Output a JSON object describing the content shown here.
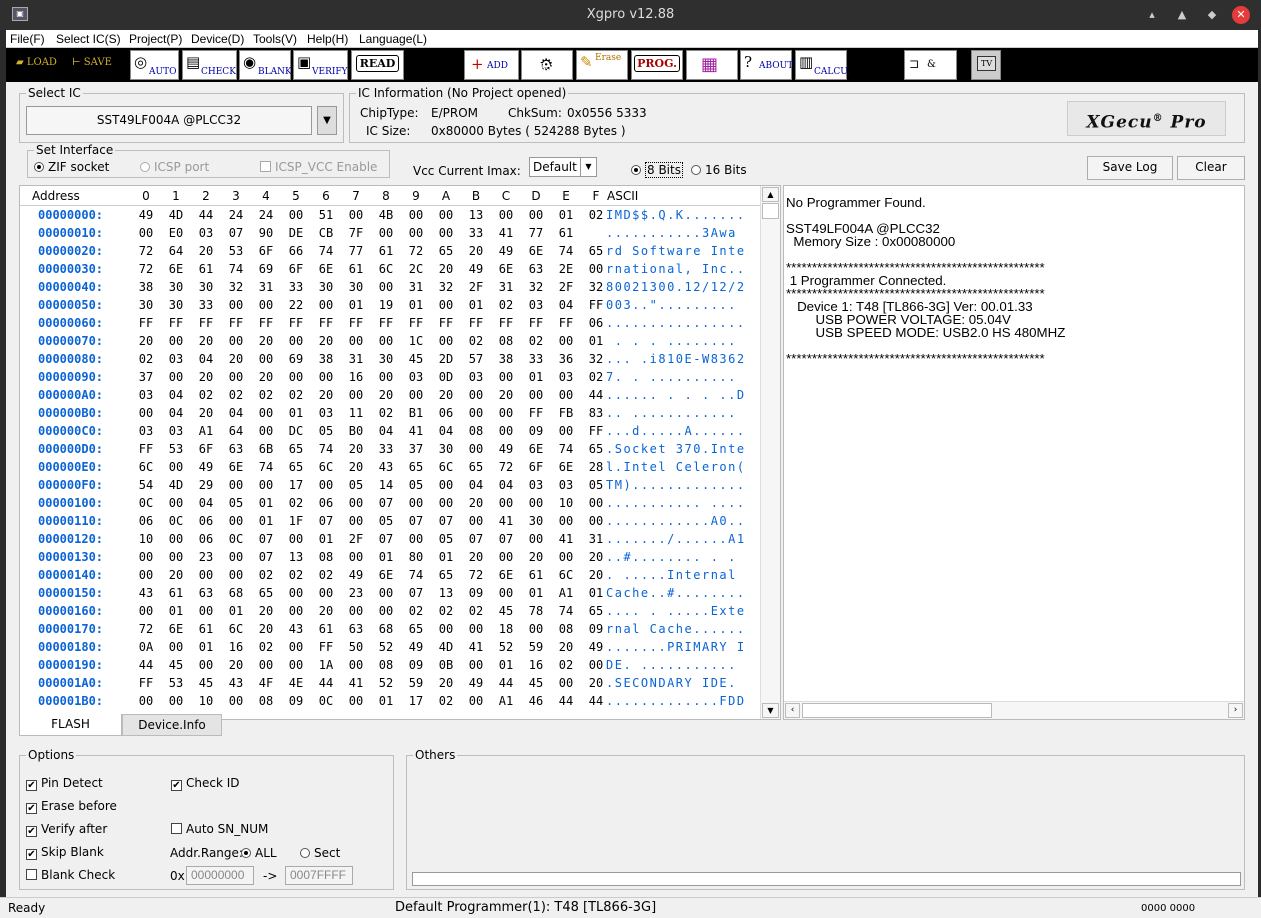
{
  "window": {
    "title": "Xgpro v12.88",
    "app_icon": "xgpro-app-icon"
  },
  "menu": [
    "File(F)",
    "Select IC(S)",
    "Project(P)",
    "Device(D)",
    "Tools(V)",
    "Help(H)",
    "Language(L)"
  ],
  "toolbar": {
    "load": "LOAD",
    "save": "SAVE",
    "auto": "AUTO",
    "check": "CHECK",
    "blank": "BLANK",
    "verify": "VERIFY",
    "read": "READ",
    "add": "ADD",
    "ram": "RAM",
    "erase": "Erase",
    "prog": "PROG.",
    "about": "ABOUT",
    "calcu": "CALCU.",
    "logic": "&",
    "tv": "TV"
  },
  "select_ic": {
    "group_label": "Select IC",
    "value": "SST49LF004A @PLCC32"
  },
  "ic_info": {
    "group_label": "IC Information (No Project opened)",
    "chiptype_label": "ChipType:",
    "chiptype": "E/PROM",
    "chksum_label": "ChkSum:",
    "chksum": "0x0556 5333",
    "icsize_label": "IC Size:",
    "icsize": "0x80000 Bytes ( 524288 Bytes )",
    "logo": "XGecu",
    "logo_reg": "®",
    "logo_tail": "Pro"
  },
  "interface": {
    "group_label": "Set Interface",
    "zif": "ZIF socket",
    "icsp": "ICSP port",
    "icsp_vcc": "ICSP_VCC Enable"
  },
  "vcc": {
    "label": "Vcc Current Imax:",
    "value": "Default"
  },
  "bits": {
    "b8": "8 Bits",
    "b16": "16 Bits"
  },
  "buttons": {
    "save_log": "Save Log",
    "clear": "Clear"
  },
  "hex": {
    "address_header": "Address",
    "columns": [
      "0",
      "1",
      "2",
      "3",
      "4",
      "5",
      "6",
      "7",
      "8",
      "9",
      "A",
      "B",
      "C",
      "D",
      "E",
      "F"
    ],
    "ascii_header": "ASCII",
    "rows": [
      {
        "a": "00000000:",
        "h": [
          "49",
          "4D",
          "44",
          "24",
          "24",
          "00",
          "51",
          "00",
          "4B",
          "00",
          "00",
          "13",
          "00",
          "00",
          "01",
          "02"
        ],
        "t": "IMD$$.Q.K......."
      },
      {
        "a": "00000010:",
        "h": [
          "00",
          "E0",
          "03",
          "07",
          "90",
          "DE",
          "CB",
          "7F",
          "00",
          "00",
          "00",
          "33",
          "41",
          "77",
          "61"
        ],
        "t": "...........3Awa"
      },
      {
        "a": "00000020:",
        "h": [
          "72",
          "64",
          "20",
          "53",
          "6F",
          "66",
          "74",
          "77",
          "61",
          "72",
          "65",
          "20",
          "49",
          "6E",
          "74",
          "65"
        ],
        "t": "rd Software Inte"
      },
      {
        "a": "00000030:",
        "h": [
          "72",
          "6E",
          "61",
          "74",
          "69",
          "6F",
          "6E",
          "61",
          "6C",
          "2C",
          "20",
          "49",
          "6E",
          "63",
          "2E",
          "00"
        ],
        "t": "rnational, Inc.."
      },
      {
        "a": "00000040:",
        "h": [
          "38",
          "30",
          "30",
          "32",
          "31",
          "33",
          "30",
          "30",
          "00",
          "31",
          "32",
          "2F",
          "31",
          "32",
          "2F",
          "32"
        ],
        "t": "80021300.12/12/2"
      },
      {
        "a": "00000050:",
        "h": [
          "30",
          "30",
          "33",
          "00",
          "00",
          "22",
          "00",
          "01",
          "19",
          "01",
          "00",
          "01",
          "02",
          "03",
          "04",
          "FF"
        ],
        "t": "003..\"........."
      },
      {
        "a": "00000060:",
        "h": [
          "FF",
          "FF",
          "FF",
          "FF",
          "FF",
          "FF",
          "FF",
          "FF",
          "FF",
          "FF",
          "FF",
          "FF",
          "FF",
          "FF",
          "FF",
          "06"
        ],
        "t": "................"
      },
      {
        "a": "00000070:",
        "h": [
          "20",
          "00",
          "20",
          "00",
          "20",
          "00",
          "20",
          "00",
          "00",
          "1C",
          "00",
          "02",
          "08",
          "02",
          "00",
          "01"
        ],
        "t": " . . . ........"
      },
      {
        "a": "00000080:",
        "h": [
          "02",
          "03",
          "04",
          "20",
          "00",
          "69",
          "38",
          "31",
          "30",
          "45",
          "2D",
          "57",
          "38",
          "33",
          "36",
          "32"
        ],
        "t": "... .i810E-W8362"
      },
      {
        "a": "00000090:",
        "h": [
          "37",
          "00",
          "20",
          "00",
          "20",
          "00",
          "00",
          "16",
          "00",
          "03",
          "0D",
          "03",
          "00",
          "01",
          "03",
          "02"
        ],
        "t": "7. . .........."
      },
      {
        "a": "000000A0:",
        "h": [
          "03",
          "04",
          "02",
          "02",
          "02",
          "02",
          "20",
          "00",
          "20",
          "00",
          "20",
          "00",
          "20",
          "00",
          "00",
          "44"
        ],
        "t": "...... . . . ..D"
      },
      {
        "a": "000000B0:",
        "h": [
          "00",
          "04",
          "20",
          "04",
          "00",
          "01",
          "03",
          "11",
          "02",
          "B1",
          "06",
          "00",
          "00",
          "FF",
          "FB",
          "83"
        ],
        "t": ".. ............"
      },
      {
        "a": "000000C0:",
        "h": [
          "03",
          "03",
          "A1",
          "64",
          "00",
          "DC",
          "05",
          "B0",
          "04",
          "41",
          "04",
          "08",
          "00",
          "09",
          "00",
          "FF"
        ],
        "t": "...d.....A......"
      },
      {
        "a": "000000D0:",
        "h": [
          "FF",
          "53",
          "6F",
          "63",
          "6B",
          "65",
          "74",
          "20",
          "33",
          "37",
          "30",
          "00",
          "49",
          "6E",
          "74",
          "65"
        ],
        "t": ".Socket 370.Inte"
      },
      {
        "a": "000000E0:",
        "h": [
          "6C",
          "00",
          "49",
          "6E",
          "74",
          "65",
          "6C",
          "20",
          "43",
          "65",
          "6C",
          "65",
          "72",
          "6F",
          "6E",
          "28"
        ],
        "t": "l.Intel Celeron("
      },
      {
        "a": "000000F0:",
        "h": [
          "54",
          "4D",
          "29",
          "00",
          "00",
          "17",
          "00",
          "05",
          "14",
          "05",
          "00",
          "04",
          "04",
          "03",
          "03",
          "05"
        ],
        "t": "TM)............."
      },
      {
        "a": "00000100:",
        "h": [
          "0C",
          "00",
          "04",
          "05",
          "01",
          "02",
          "06",
          "00",
          "07",
          "00",
          "00",
          "20",
          "00",
          "00",
          "10",
          "00"
        ],
        "t": "........... ...."
      },
      {
        "a": "00000110:",
        "h": [
          "06",
          "0C",
          "06",
          "00",
          "01",
          "1F",
          "07",
          "00",
          "05",
          "07",
          "07",
          "00",
          "41",
          "30",
          "00",
          "00"
        ],
        "t": "............A0.."
      },
      {
        "a": "00000120:",
        "h": [
          "10",
          "00",
          "06",
          "0C",
          "07",
          "00",
          "01",
          "2F",
          "07",
          "00",
          "05",
          "07",
          "07",
          "00",
          "41",
          "31"
        ],
        "t": "......./......A1"
      },
      {
        "a": "00000130:",
        "h": [
          "00",
          "00",
          "23",
          "00",
          "07",
          "13",
          "08",
          "00",
          "01",
          "80",
          "01",
          "20",
          "00",
          "20",
          "00",
          "20"
        ],
        "t": "..#........ . ."
      },
      {
        "a": "00000140:",
        "h": [
          "00",
          "20",
          "00",
          "00",
          "02",
          "02",
          "02",
          "49",
          "6E",
          "74",
          "65",
          "72",
          "6E",
          "61",
          "6C",
          "20"
        ],
        "t": ". .....Internal "
      },
      {
        "a": "00000150:",
        "h": [
          "43",
          "61",
          "63",
          "68",
          "65",
          "00",
          "00",
          "23",
          "00",
          "07",
          "13",
          "09",
          "00",
          "01",
          "A1",
          "01"
        ],
        "t": "Cache..#........"
      },
      {
        "a": "00000160:",
        "h": [
          "00",
          "01",
          "00",
          "01",
          "20",
          "00",
          "20",
          "00",
          "00",
          "02",
          "02",
          "02",
          "45",
          "78",
          "74",
          "65"
        ],
        "t": ".... . .....Exte"
      },
      {
        "a": "00000170:",
        "h": [
          "72",
          "6E",
          "61",
          "6C",
          "20",
          "43",
          "61",
          "63",
          "68",
          "65",
          "00",
          "00",
          "18",
          "00",
          "08",
          "09"
        ],
        "t": "rnal Cache......"
      },
      {
        "a": "00000180:",
        "h": [
          "0A",
          "00",
          "01",
          "16",
          "02",
          "00",
          "FF",
          "50",
          "52",
          "49",
          "4D",
          "41",
          "52",
          "59",
          "20",
          "49"
        ],
        "t": ".......PRIMARY I"
      },
      {
        "a": "00000190:",
        "h": [
          "44",
          "45",
          "00",
          "20",
          "00",
          "00",
          "1A",
          "00",
          "08",
          "09",
          "0B",
          "00",
          "01",
          "16",
          "02",
          "00"
        ],
        "t": "DE. ..........."
      },
      {
        "a": "000001A0:",
        "h": [
          "FF",
          "53",
          "45",
          "43",
          "4F",
          "4E",
          "44",
          "41",
          "52",
          "59",
          "20",
          "49",
          "44",
          "45",
          "00",
          "20"
        ],
        "t": ".SECONDARY IDE. "
      },
      {
        "a": "000001B0:",
        "h": [
          "00",
          "00",
          "10",
          "00",
          "08",
          "09",
          "0C",
          "00",
          "01",
          "17",
          "02",
          "00",
          "A1",
          "46",
          "44",
          "44"
        ],
        "t": ".............FDD"
      }
    ]
  },
  "log": {
    "lines": [
      "No Programmer Found.",
      "",
      "SST49LF004A @PLCC32",
      "  Memory Size : 0x00080000",
      "",
      "**************************************************",
      " 1 Programmer Connected.",
      "**************************************************",
      "   Device 1: T48 [TL866-3G] Ver: 00.01.33",
      "        USB POWER VOLTAGE: 05.04V",
      "        USB SPEED MODE: USB2.0 HS 480MHZ",
      "",
      "**************************************************"
    ]
  },
  "tabs": {
    "flash": "FLASH",
    "device_info": "Device.Info"
  },
  "options": {
    "group_label": "Options",
    "pin_detect": "Pin Detect",
    "check_id": "Check ID",
    "erase_before": "Erase before",
    "verify_after": "Verify after",
    "auto_sn": "Auto SN_NUM",
    "skip_blank": "Skip Blank",
    "blank_check": "Blank Check",
    "addr_range": "Addr.Range:",
    "all": "ALL",
    "sect": "Sect",
    "ox": "0x",
    "arrow": "->",
    "addr_from": "00000000",
    "addr_to": "0007FFFF"
  },
  "others": {
    "group_label": "Others"
  },
  "status": {
    "left": "Ready",
    "center": "Default Programmer(1): T48 [TL866-3G]",
    "right": "0000 0000"
  }
}
